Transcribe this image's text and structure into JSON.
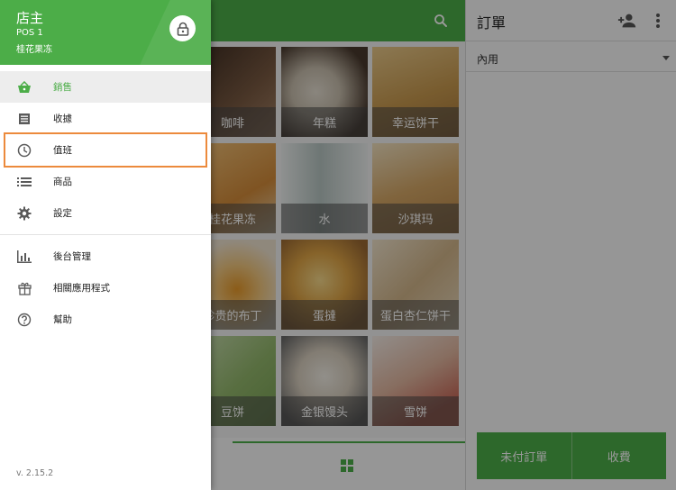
{
  "topbar": {
    "search_icon": "search-icon"
  },
  "products": [
    {
      "name": "咖啡",
      "bg": "#6b4a34"
    },
    {
      "name": "年糕",
      "bg": "#8b7c6a"
    },
    {
      "name": "幸运饼干",
      "bg": "#c9a15f"
    },
    {
      "name": "桂花果冻",
      "bg": "#d7a050"
    },
    {
      "name": "水",
      "bg": "#b9c4c2"
    },
    {
      "name": "沙琪玛",
      "bg": "#c89a58"
    },
    {
      "name": "珍贵的布丁",
      "bg": "#d08a34"
    },
    {
      "name": "蛋撻",
      "bg": "#d7a24d"
    },
    {
      "name": "蛋白杏仁饼干",
      "bg": "#d8bd93"
    },
    {
      "name": "豆饼",
      "bg": "#9ec27a"
    },
    {
      "name": "金银馒头",
      "bg": "#a8a8a8"
    },
    {
      "name": "雪饼",
      "bg": "#d9b8a0"
    }
  ],
  "order": {
    "title": "訂單",
    "dine_option": "內用",
    "unpaid_label": "未付訂單",
    "checkout_label": "收費"
  },
  "drawer": {
    "user_name": "店主",
    "pos_name": "POS 1",
    "store_name": "桂花果冻",
    "menu": [
      {
        "label": "銷售",
        "icon": "shopping-basket-icon",
        "active": true
      },
      {
        "label": "收據",
        "icon": "receipt-icon",
        "active": false
      },
      {
        "label": "值班",
        "icon": "clock-icon",
        "active": false
      },
      {
        "label": "商品",
        "icon": "list-icon",
        "active": false
      },
      {
        "label": "設定",
        "icon": "gear-icon",
        "active": false
      }
    ],
    "secondary_menu": [
      {
        "label": "後台管理",
        "icon": "bar-chart-icon"
      },
      {
        "label": "相關應用程式",
        "icon": "gift-icon"
      },
      {
        "label": "幫助",
        "icon": "help-icon"
      }
    ],
    "version": "v. 2.15.2"
  },
  "colors": {
    "accent": "#4cad48",
    "highlight": "#ec8a3c"
  }
}
